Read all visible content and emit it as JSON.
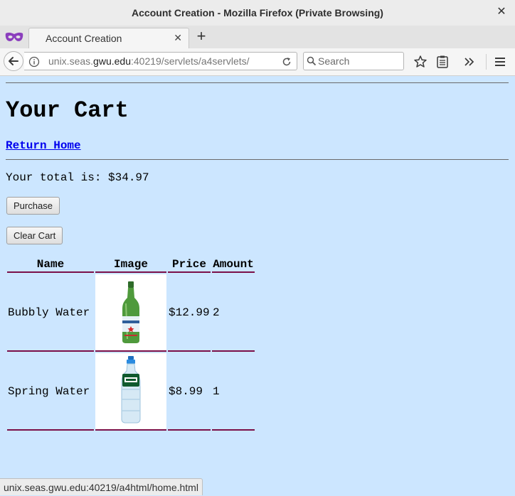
{
  "window": {
    "title": "Account Creation - Mozilla Firefox (Private Browsing)",
    "close_icon": "close-icon"
  },
  "tabs": [
    {
      "label": "Account Creation",
      "active": true
    }
  ],
  "navbar": {
    "url_host_prefix": "unix.seas.",
    "url_host_domain": "gwu.edu",
    "url_rest": ":40219/servlets/a4servlets/",
    "search_placeholder": "Search"
  },
  "page": {
    "title": "Your Cart",
    "home_link": "Return Home",
    "total_label": "Your total is: $34.97",
    "purchase_button": "Purchase",
    "clear_button": "Clear Cart",
    "columns": [
      "Name",
      "Image",
      "Price",
      "Amount"
    ],
    "rows": [
      {
        "name": "Bubbly Water",
        "image": "green-glass-bottle",
        "price": "$12.99",
        "amount": "2"
      },
      {
        "name": "Spring Water",
        "image": "clear-plastic-bottle",
        "price": "$8.99",
        "amount": "1"
      }
    ]
  },
  "statusbar": {
    "text": "unix.seas.gwu.edu:40219/a4html/home.html"
  },
  "colors": {
    "page_background": "#cce6ff",
    "link": "#0000ee",
    "table_rule": "#7a0f48",
    "private_mask": "#8b3ebd"
  }
}
